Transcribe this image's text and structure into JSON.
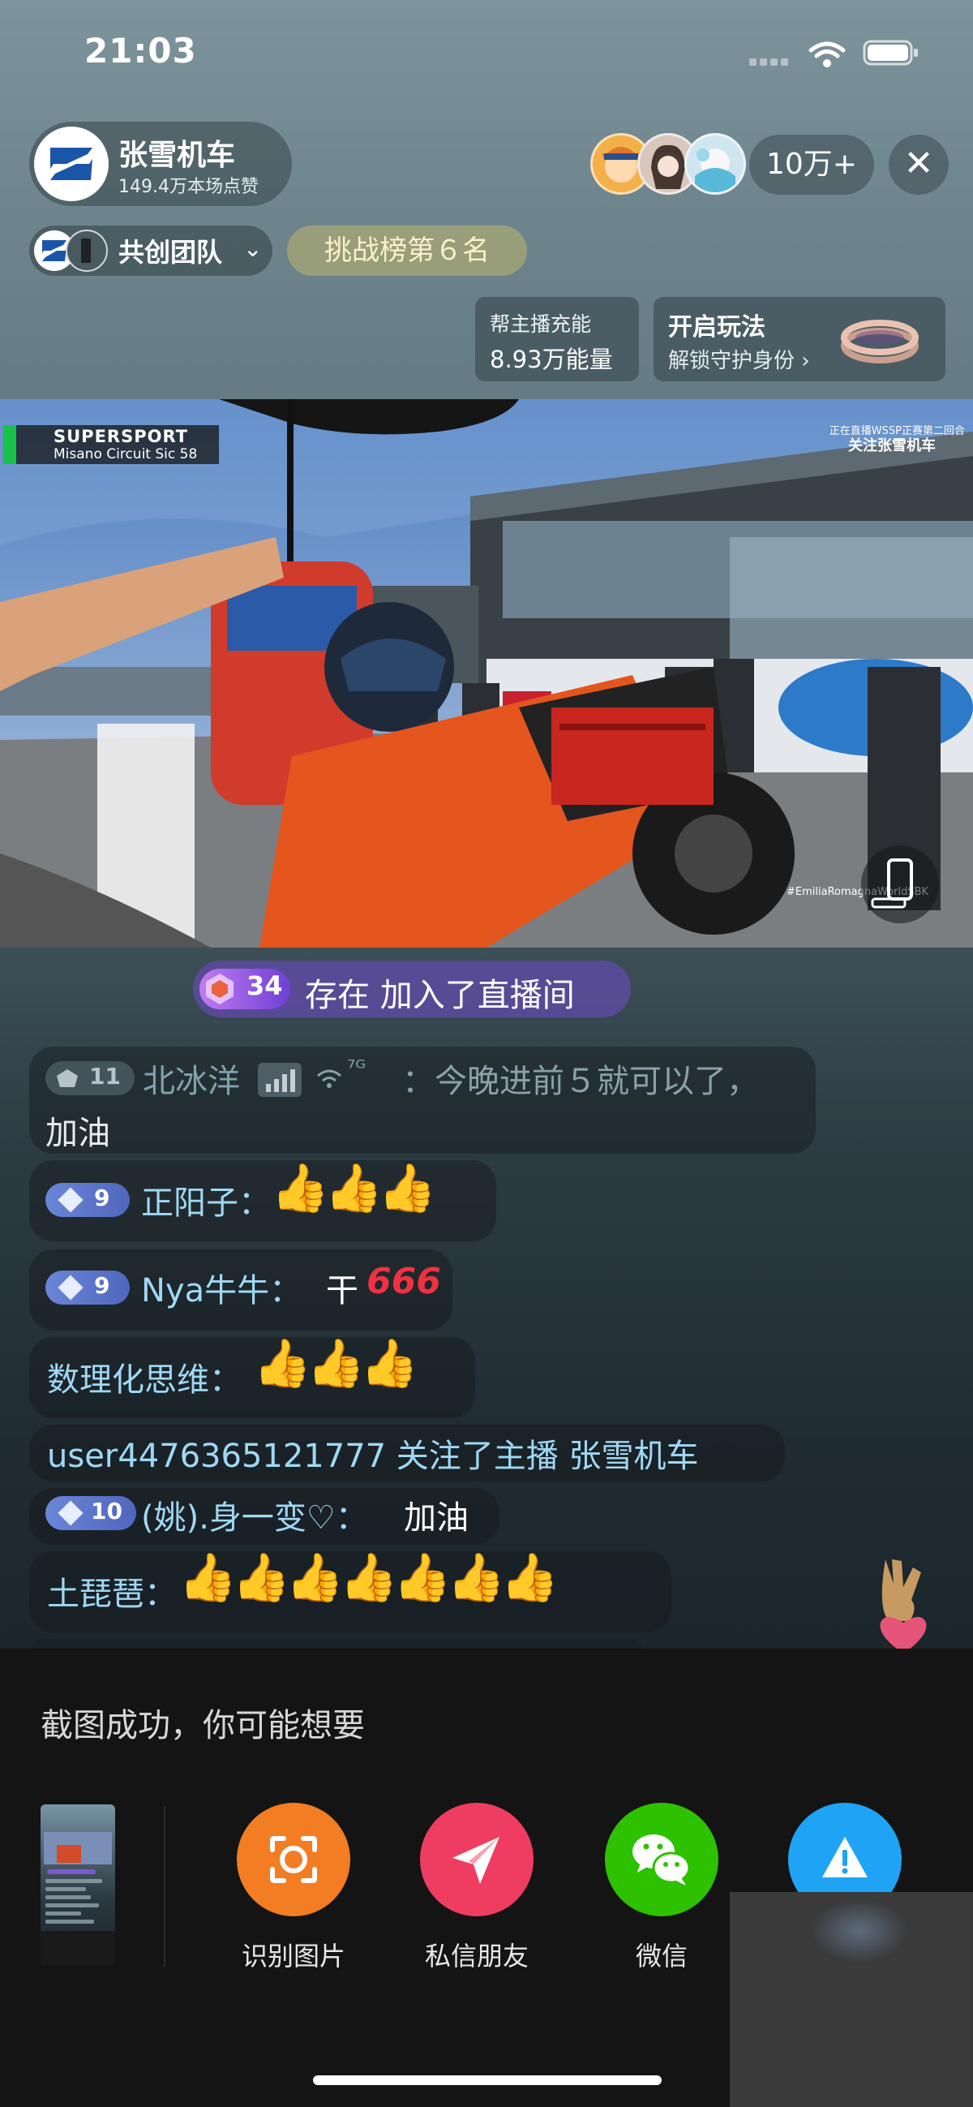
{
  "status_bar": {
    "time": "21:03"
  },
  "host": {
    "name": "张雪机车",
    "likes": "149.4万本场点赞"
  },
  "viewers": {
    "count": "10万+"
  },
  "close": {
    "symbol": "✕"
  },
  "team": {
    "label": "共创团队",
    "chevron": "⌄"
  },
  "rank": {
    "label": "挑战榜第６名"
  },
  "energy": {
    "title": "帮主播充能",
    "value": "8.93万能量"
  },
  "play": {
    "title": "开启玩法",
    "subtitle": "解锁守护身份 ›"
  },
  "video": {
    "overlay_title": "SUPERSPORT",
    "overlay_sub": "Misano Circuit Sic 58",
    "top_note": "正在直播WSSP正赛第二回合",
    "follow_note": "关注张雪机车",
    "hashtag": "#EmiliaRomagnaWorldSBK"
  },
  "join_banner": {
    "level": "34",
    "text": "存在 加入了直播间"
  },
  "chat": [
    {
      "level": "11",
      "user": "北冰洋",
      "network": "⁷ᴳ",
      "message": "：今晚进前５就可以了，",
      "message2": "加油"
    },
    {
      "level": "9",
      "user": "正阳子：",
      "thumbs": "👍👍👍"
    },
    {
      "level": "9",
      "user": "Nya牛牛：",
      "message": "干",
      "highlight": "666"
    },
    {
      "user": "数理化思维：",
      "thumbs": "👍👍👍"
    },
    {
      "message": "user4476365121777 关注了主播 张雪机车"
    },
    {
      "level": "10",
      "user": "(姚).身一变♡：",
      "message": "加油"
    },
    {
      "user": "土琵琶：",
      "thumbs": "👍👍👍👍👍👍👍"
    }
  ],
  "sheet": {
    "title": "截图成功，你可能想要",
    "actions": [
      {
        "label": "识别图片",
        "icon": "scan-icon",
        "color": "#f37d22"
      },
      {
        "label": "私信朋友",
        "icon": "send-icon",
        "color": "#ef3d62"
      },
      {
        "label": "微信",
        "icon": "wechat-icon",
        "color": "#2dc100"
      },
      {
        "label": "",
        "icon": "warning-icon",
        "color": "#1fa3f5"
      }
    ]
  }
}
